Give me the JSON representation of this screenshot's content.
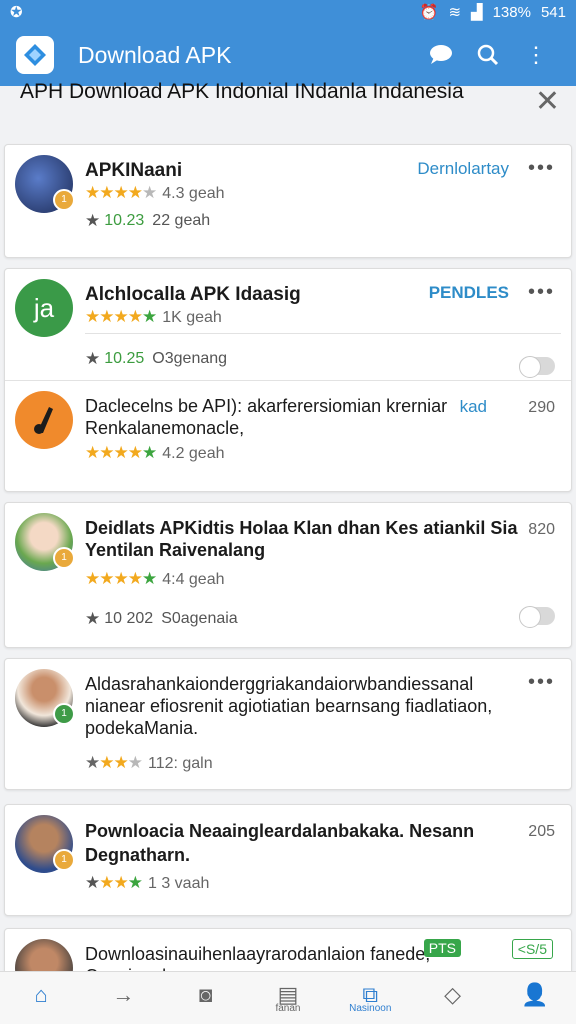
{
  "status_bar": {
    "battery": "138%",
    "time": "541"
  },
  "appbar": {
    "title": "Download APK"
  },
  "banner": {
    "text": "APH  Download APK Indonial INdanla Indanesia"
  },
  "apps": [
    {
      "name": "APKINaani",
      "tag": "Dernlolartay",
      "meta1": "4.3 geah",
      "val2": "10.23",
      "meta2": "22 geah"
    },
    {
      "name": "Alchlocalla APK Idaasig",
      "tag": "PENDLES",
      "meta1": "1K geah",
      "val2": "10.25",
      "meta2": "O3genang"
    },
    {
      "name": "Daclecelns be API): akarferersiomian krerniar Renkalanemonacle,",
      "link": "kad",
      "count": "290",
      "meta1": "4.2 geah"
    },
    {
      "name": "Deidlats APKidtis Holaa Klan dhan Kes atiankil Sia Yentilan Raivenalang",
      "count": "820",
      "meta1": "4:4 geah",
      "val2": "10 202",
      "meta2": "S0agenaia"
    },
    {
      "name": "Aldasrahankaionderggriakandaiorwbandiessanal nianear efiosrenit agiotiatian bearnsang fiadlatiaon, podekaMania.",
      "meta1": "112: galn"
    },
    {
      "name": "Pownloacia Neaainglear­dalanbakaka. Nesann Degnatharn.",
      "count": "205",
      "meta1": "1 3 vaah"
    },
    {
      "name": "Downloasinauihenlaayrarodanlaion fanede,",
      "name2": "Conainnala",
      "chip1": "PTS",
      "chip2": "<S/5"
    }
  ],
  "nav": {
    "label4": "fanan",
    "label5": "Nasinoon"
  },
  "colors": {
    "primary": "#3f8fd8",
    "accent_green": "#3ca53f",
    "star_gold": "#f2a91e"
  }
}
